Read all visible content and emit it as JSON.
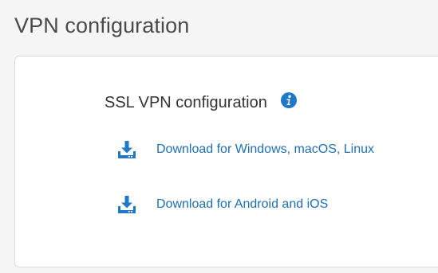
{
  "page": {
    "title": "VPN configuration"
  },
  "ssl_vpn": {
    "title": "SSL VPN configuration",
    "info_icon": "info-circle-icon",
    "downloads": [
      {
        "label": "Download for Windows, macOS, Linux",
        "icon": "download-icon"
      },
      {
        "label": "Download for Android and iOS",
        "icon": "download-icon"
      }
    ]
  },
  "colors": {
    "accent": "#1f78c8",
    "link": "#1f6fb2",
    "title": "#4a4a4a",
    "background": "#f5f5f5",
    "card": "#ffffff"
  }
}
